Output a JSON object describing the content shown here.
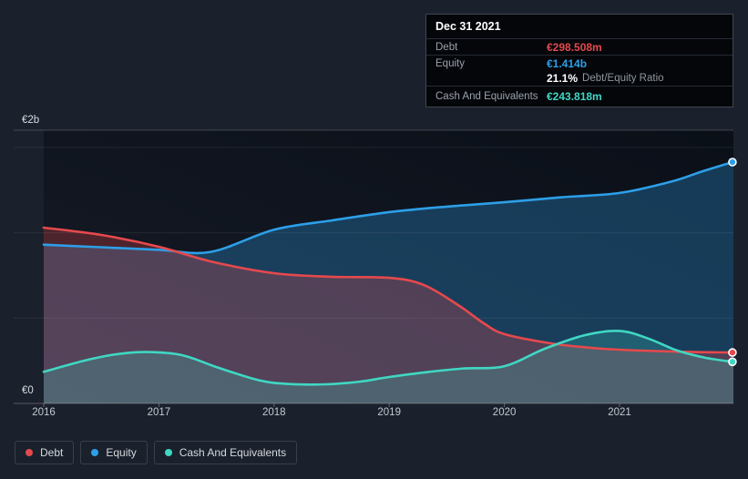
{
  "page": {
    "background": "#1b212c"
  },
  "tooltip": {
    "date": "Dec 31 2021",
    "rows": [
      {
        "label": "Debt",
        "value": "€298.508m",
        "color": "#e5494d"
      },
      {
        "label": "Equity",
        "value": "€1.414b",
        "color": "#2d9fe8"
      },
      {
        "label": "Cash And Equivalents",
        "value": "€243.818m",
        "color": "#40d7c3"
      }
    ],
    "ratio": {
      "value": "21.1%",
      "label": "Debt/Equity Ratio"
    }
  },
  "legend": {
    "items": [
      {
        "label": "Debt",
        "color": "#e5494d"
      },
      {
        "label": "Equity",
        "color": "#2d9fe8"
      },
      {
        "label": "Cash And Equivalents",
        "color": "#40d7c3"
      }
    ]
  },
  "chart_data": {
    "type": "area",
    "currency": "EUR",
    "y_axis": {
      "top_label": "€2b",
      "bottom_label": "€0",
      "range_b": [
        0,
        2
      ],
      "gridline_values_b": [
        0.5,
        1.0,
        1.5
      ],
      "grid": true
    },
    "x_axis": {
      "ticks": [
        "2016",
        "2017",
        "2018",
        "2019",
        "2020",
        "2021"
      ],
      "range_years": [
        2016,
        2022
      ]
    },
    "legend_position": "bottom-left",
    "series": [
      {
        "name": "Debt",
        "color": "#e5494d",
        "unit": "EUR billions",
        "points": [
          [
            2016.0,
            1.03
          ],
          [
            2016.5,
            0.987
          ],
          [
            2017.0,
            0.918
          ],
          [
            2017.45,
            0.832
          ],
          [
            2018.0,
            0.763
          ],
          [
            2018.5,
            0.742
          ],
          [
            2019.0,
            0.736
          ],
          [
            2019.3,
            0.694
          ],
          [
            2019.6,
            0.576
          ],
          [
            2019.82,
            0.47
          ],
          [
            2020.0,
            0.406
          ],
          [
            2020.4,
            0.352
          ],
          [
            2020.75,
            0.326
          ],
          [
            2021.0,
            0.315
          ],
          [
            2021.5,
            0.303
          ],
          [
            2021.98,
            0.2985
          ]
        ]
      },
      {
        "name": "Equity",
        "color": "#2d9fe8",
        "unit": "EUR billions",
        "points": [
          [
            2016.0,
            0.93
          ],
          [
            2016.5,
            0.915
          ],
          [
            2017.0,
            0.9
          ],
          [
            2017.45,
            0.888
          ],
          [
            2018.0,
            1.018
          ],
          [
            2018.5,
            1.072
          ],
          [
            2019.0,
            1.121
          ],
          [
            2019.5,
            1.153
          ],
          [
            2020.0,
            1.179
          ],
          [
            2020.5,
            1.208
          ],
          [
            2021.0,
            1.233
          ],
          [
            2021.45,
            1.3
          ],
          [
            2021.72,
            1.36
          ],
          [
            2021.98,
            1.414
          ]
        ]
      },
      {
        "name": "Cash And Equivalents",
        "color": "#40d7c3",
        "unit": "EUR billions",
        "points": [
          [
            2016.0,
            0.185
          ],
          [
            2016.35,
            0.25
          ],
          [
            2016.65,
            0.29
          ],
          [
            2016.9,
            0.301
          ],
          [
            2017.2,
            0.283
          ],
          [
            2017.5,
            0.213
          ],
          [
            2017.85,
            0.139
          ],
          [
            2018.1,
            0.115
          ],
          [
            2018.45,
            0.112
          ],
          [
            2018.75,
            0.128
          ],
          [
            2019.0,
            0.155
          ],
          [
            2019.35,
            0.185
          ],
          [
            2019.65,
            0.205
          ],
          [
            2020.0,
            0.218
          ],
          [
            2020.35,
            0.32
          ],
          [
            2020.7,
            0.4
          ],
          [
            2021.0,
            0.425
          ],
          [
            2021.25,
            0.38
          ],
          [
            2021.5,
            0.31
          ],
          [
            2021.75,
            0.267
          ],
          [
            2021.98,
            0.244
          ]
        ]
      }
    ],
    "end_values": {
      "Debt": "€298.508m",
      "Equity": "€1.414b",
      "Cash And Equivalents": "€243.818m",
      "debt_equity_ratio": "21.1%"
    }
  }
}
